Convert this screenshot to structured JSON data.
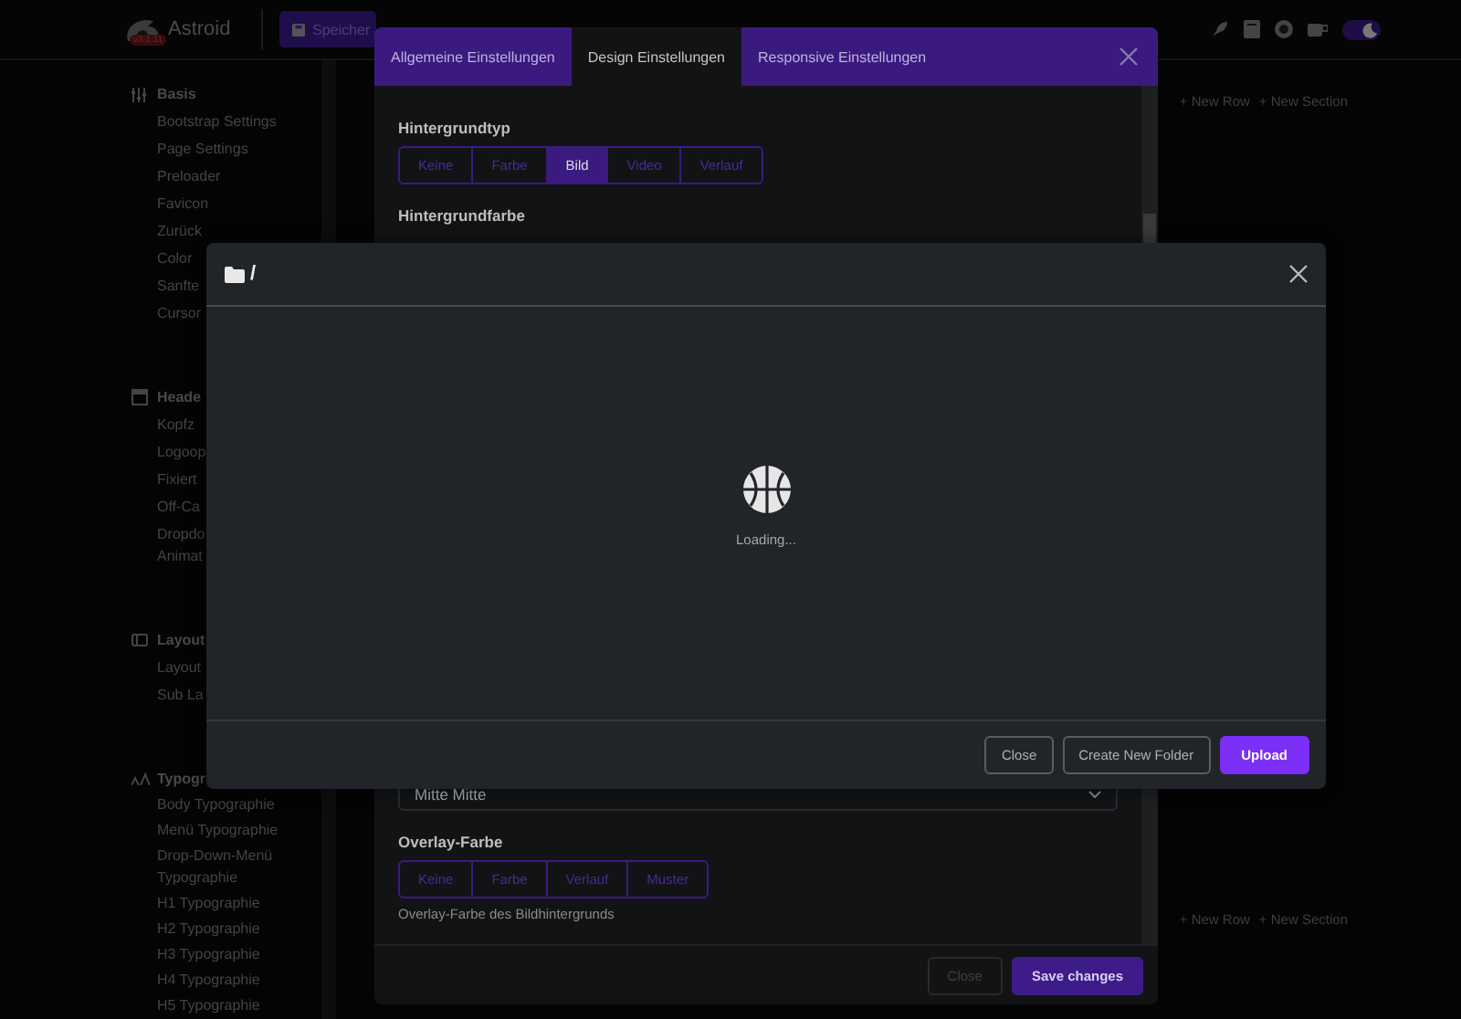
{
  "header": {
    "logo_text": "Astroid",
    "version": "v3.1.11",
    "save_button": "Speicher",
    "dark_mode": true
  },
  "sidebar": {
    "sections": [
      {
        "title": "Basis",
        "items": [
          "Bootstrap Settings",
          "Page Settings",
          "Preloader",
          "Favicon",
          "Zurück",
          "Color",
          "Sanfte",
          "Cursor"
        ]
      },
      {
        "title": "Heade",
        "items": [
          "Kopfz",
          "Logoop",
          "Fixiert",
          "Off-Ca",
          "Dropdo\nAnimat"
        ]
      },
      {
        "title": "Layout",
        "items": [
          "Layout",
          "Sub La"
        ]
      },
      {
        "title": "Typogr",
        "items": [
          "Body Typographie",
          "Menü Typographie",
          "Drop-Down-Menü Typographie",
          "H1 Typographie",
          "H2 Typographie",
          "H3 Typographie",
          "H4 Typographie",
          "H5 Typographie"
        ]
      }
    ]
  },
  "main": {
    "toolbars": [
      {
        "actions": [
          "+ New Row",
          "+ New Section"
        ]
      },
      {
        "actions": [
          "+ New Row",
          "+ New Section"
        ]
      }
    ]
  },
  "settings_dialog": {
    "tabs": [
      {
        "label": "Allgemeine Einstellungen",
        "selected": false
      },
      {
        "label": "Design Einstellungen",
        "selected": true
      },
      {
        "label": "Responsive Einstellungen",
        "selected": false
      }
    ],
    "fields": [
      {
        "kind": "segmented",
        "label": "Hintergrundtyp",
        "options": [
          {
            "label": "Keine",
            "selected": false
          },
          {
            "label": "Farbe",
            "selected": false
          },
          {
            "label": "Bild",
            "selected": true
          },
          {
            "label": "Video",
            "selected": false
          },
          {
            "label": "Verlauf",
            "selected": false
          }
        ]
      },
      {
        "kind": "heading",
        "label": "Hintergrundfarbe"
      },
      {
        "kind": "select",
        "value": "Mitte Mitte"
      },
      {
        "kind": "segmented",
        "label": "Overlay-Farbe",
        "options": [
          {
            "label": "Keine",
            "selected": false
          },
          {
            "label": "Farbe",
            "selected": false
          },
          {
            "label": "Verlauf",
            "selected": false
          },
          {
            "label": "Muster",
            "selected": false
          }
        ],
        "help": "Overlay-Farbe des Bildhintergrunds"
      }
    ],
    "buttons": [
      {
        "label": "Close",
        "disabled": true,
        "primary": false
      },
      {
        "label": "Save changes",
        "disabled": false,
        "primary": true
      }
    ]
  },
  "file_dialog": {
    "title": "/",
    "status": "Loading...",
    "buttons": [
      {
        "label": "Close",
        "primary": false
      },
      {
        "label": "Create New Folder",
        "primary": false
      },
      {
        "label": "Upload",
        "primary": true
      }
    ]
  }
}
